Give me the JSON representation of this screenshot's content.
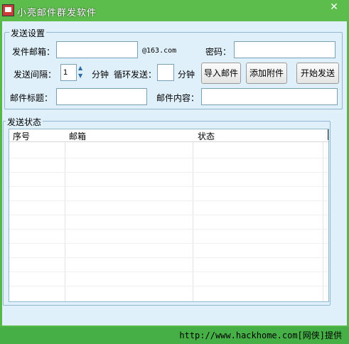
{
  "window": {
    "title": "小亮邮件群发软件",
    "close_glyph": "✕"
  },
  "send_settings": {
    "title": "发送设置",
    "sender_label": "发件邮箱：",
    "sender_value": "",
    "domain_suffix": "@163.com",
    "password_label": "密码：",
    "password_value": "",
    "interval_label": "发送间隔：",
    "interval_value": "1",
    "interval_unit": "分钟",
    "loop_label": "循环发送：",
    "loop_value": "",
    "loop_unit": "分钟",
    "import_button": "导入邮件",
    "attach_button": "添加附件",
    "start_button": "开始发送",
    "subject_label": "邮件标题：",
    "subject_value": "",
    "content_label": "邮件内容：",
    "content_value": ""
  },
  "send_status": {
    "title": "发送状态",
    "columns": [
      "序号",
      "邮箱",
      "状态"
    ],
    "rows": []
  },
  "footer": {
    "text": "http://www.hackhome.com[网侠]提供"
  },
  "colors": {
    "accent_green": "#56b846",
    "panel_bg": "#dff0fa",
    "border": "#8fb7cf"
  }
}
